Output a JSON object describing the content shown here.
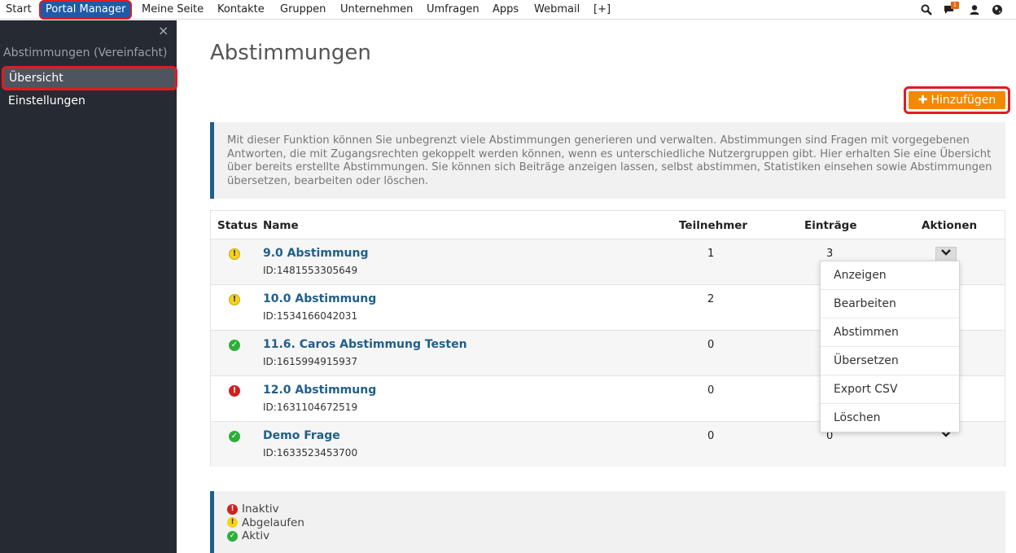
{
  "nav": {
    "items": [
      "Start",
      "Portal Manager",
      "Meine Seite",
      "Kontakte",
      "Gruppen",
      "Unternehmen",
      "Umfragen",
      "Apps",
      "Webmail",
      "[+]"
    ],
    "active_index": 1,
    "notification_count": "1",
    "icons": [
      "search-icon",
      "chat-icon",
      "user-icon",
      "globe-icon"
    ]
  },
  "sidebar": {
    "close": "×",
    "section_title": "Abstimmungen (Vereinfacht)",
    "items": [
      {
        "label": "Übersicht",
        "active": true
      },
      {
        "label": "Einstellungen",
        "active": false
      }
    ]
  },
  "main": {
    "title": "Abstimmungen",
    "add_button": "Hinzufügen",
    "intro": "Mit dieser Funktion können Sie unbegrenzt viele Abstimmungen generieren und verwalten. Abstimmungen sind Fragen mit vorgegebenen Antworten, die mit Zugangsrechten gekoppelt werden können, wenn es unterschiedliche Nutzergruppen gibt. Hier erhalten Sie eine Übersicht über bereits erstellte Abstimmungen. Sie können sich Beiträge anzeigen lassen, selbst abstimmen, Statistiken einsehen sowie Abstimmungen übersetzen, bearbeiten oder löschen."
  },
  "table": {
    "headers": {
      "status": "Status",
      "name": "Name",
      "teilnehmer": "Teilnehmer",
      "eintraege": "Einträge",
      "aktionen": "Aktionen"
    },
    "rows": [
      {
        "status": "abgelaufen",
        "name": "9.0 Abstimmung",
        "id": "ID:1481553305649",
        "teilnehmer": "1",
        "eintraege": "3"
      },
      {
        "status": "abgelaufen",
        "name": "10.0 Abstimmung",
        "id": "ID:1534166042031",
        "teilnehmer": "2",
        "eintraege": ""
      },
      {
        "status": "aktiv",
        "name": "11.6. Caros Abstimmung Testen",
        "id": "ID:1615994915937",
        "teilnehmer": "0",
        "eintraege": ""
      },
      {
        "status": "inaktiv",
        "name": "12.0 Abstimmung",
        "id": "ID:1631104672519",
        "teilnehmer": "0",
        "eintraege": ""
      },
      {
        "status": "aktiv",
        "name": "Demo Frage",
        "id": "ID:1633523453700",
        "teilnehmer": "0",
        "eintraege": "0"
      }
    ]
  },
  "dropdown": {
    "items": [
      "Anzeigen",
      "Bearbeiten",
      "Abstimmen",
      "Übersetzen",
      "Export CSV",
      "Löschen"
    ]
  },
  "legend": {
    "inaktiv": "Inaktiv",
    "abgelaufen": "Abgelaufen",
    "aktiv": "Aktiv"
  },
  "colors": {
    "accent": "#1e5aa8",
    "add_button": "#f18a00",
    "link": "#1f5f8b",
    "status_ok": "#2eae3a",
    "status_warn": "#f3d31c",
    "status_err": "#d21f1f",
    "highlight": "#e01b24"
  }
}
